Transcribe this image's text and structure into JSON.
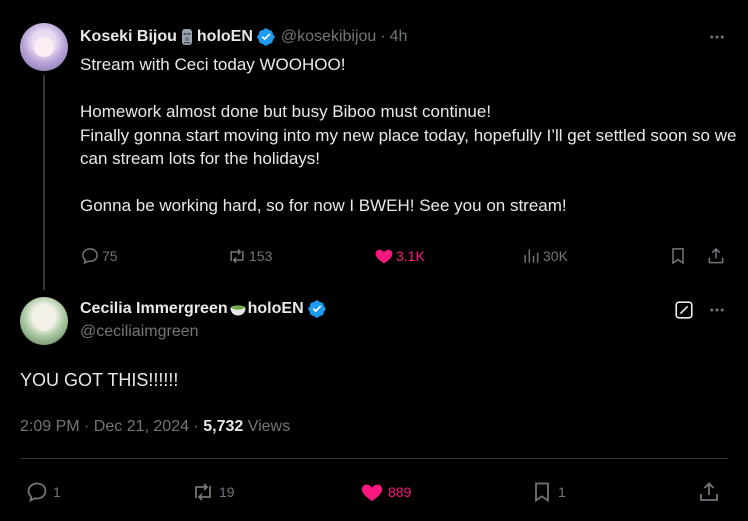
{
  "parent": {
    "author": "Koseki Bijou",
    "emoji": "moai-emoji",
    "suffix": "holoEN",
    "handle": "@kosekibijou",
    "separator": "·",
    "time": "4h",
    "text_lines": [
      "Stream with Ceci today WOOHOO!",
      "Homework almost done but busy Biboo must continue!",
      "Finally gonna start moving into my new place today, hopefully I’ll get settled soon so we can stream lots for the holidays!",
      "Gonna be working hard, so for now I BWEH! See you on stream!"
    ],
    "stats": {
      "replies": "75",
      "reposts": "153",
      "likes": "3.1K",
      "views": "30K"
    }
  },
  "reply": {
    "author": "Cecilia Immergreen",
    "emoji": "matcha-bowl-emoji",
    "suffix": "holoEN",
    "handle": "@ceciliaimgreen",
    "text": "YOU GOT THIS!!!!!!",
    "timestamp": "2:09 PM · Dec 21, 2024",
    "separator": "·",
    "view_count": "5,732",
    "views_label": "Views",
    "stats": {
      "replies": "1",
      "reposts": "19",
      "likes": "889",
      "bookmarks": "1"
    }
  },
  "colors": {
    "background": "#000000",
    "text": "#e7e9ea",
    "muted": "#71767b",
    "like": "#f91880",
    "verified": "#1d9bf0",
    "divider": "#2f3336"
  },
  "icons": [
    "more-icon",
    "verified-badge-icon",
    "reply-icon",
    "repost-icon",
    "heart-icon",
    "views-icon",
    "bookmark-icon",
    "share-icon",
    "edit-icon"
  ]
}
